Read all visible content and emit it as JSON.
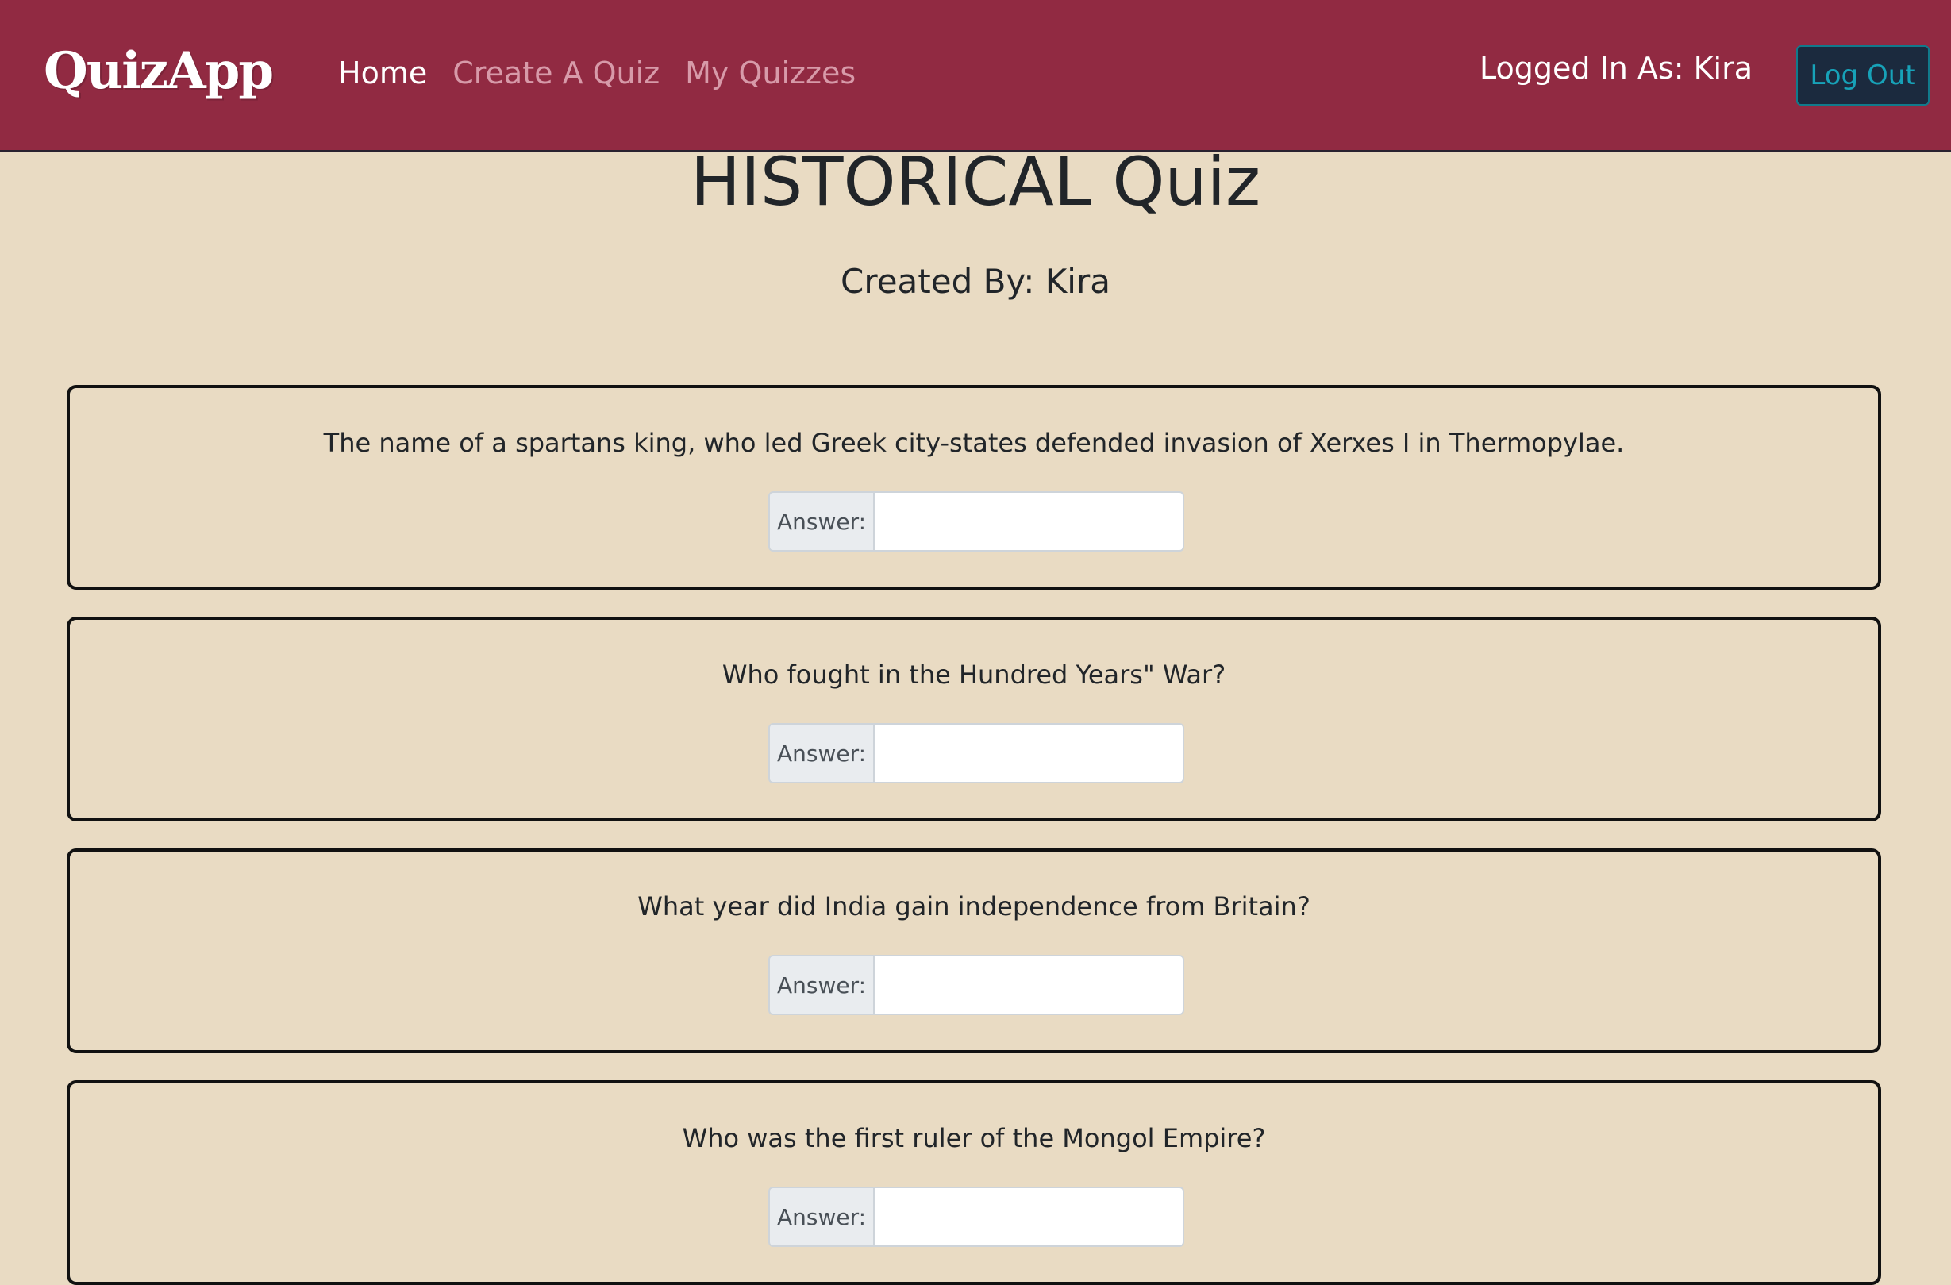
{
  "navbar": {
    "brand": "QuizApp",
    "links": [
      {
        "label": "Home",
        "active": true
      },
      {
        "label": "Create A Quiz",
        "active": false
      },
      {
        "label": "My Quizzes",
        "active": false
      }
    ],
    "logged_in_text": "Logged In As: Kira",
    "logout_label": "Log Out"
  },
  "quiz": {
    "title": "HISTORICAL Quiz",
    "created_by": "Created By: Kira",
    "answer_label": "Answer:",
    "questions": [
      {
        "text": "The name of a spartans king, who led Greek city-states defended invasion of Xerxes I in Thermopylae.",
        "answer": ""
      },
      {
        "text": "Who fought in the Hundred Years\" War?",
        "answer": ""
      },
      {
        "text": "What year did India gain independence from Britain?",
        "answer": ""
      },
      {
        "text": "Who was the first ruler of the Mongol Empire?",
        "answer": ""
      }
    ]
  },
  "colors": {
    "navbar_bg": "#912a42",
    "page_bg": "#e9dbc3",
    "logout_text": "#17a2b8",
    "nav_inactive": "#d79aa9"
  }
}
